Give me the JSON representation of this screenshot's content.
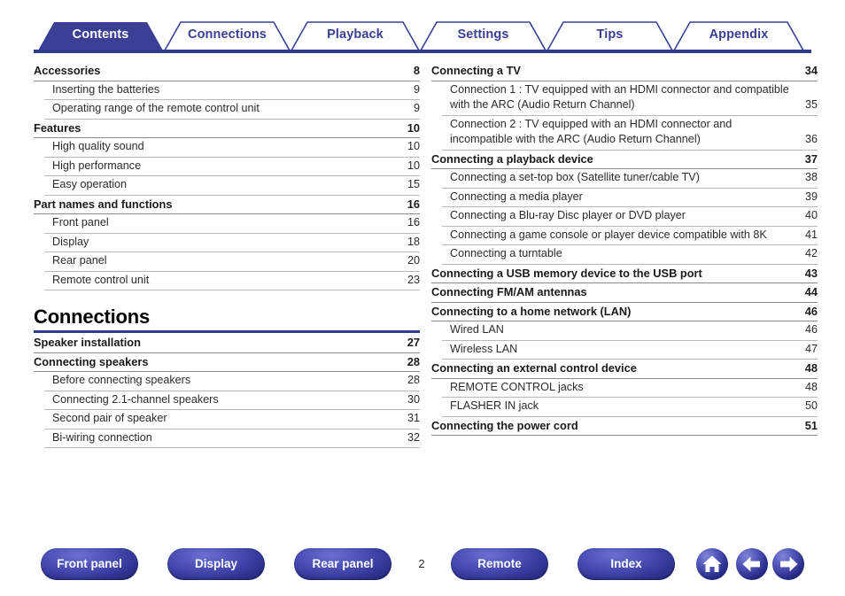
{
  "tabs": [
    {
      "label": "Contents",
      "active": true
    },
    {
      "label": "Connections",
      "active": false
    },
    {
      "label": "Playback",
      "active": false
    },
    {
      "label": "Settings",
      "active": false
    },
    {
      "label": "Tips",
      "active": false
    },
    {
      "label": "Appendix",
      "active": false
    }
  ],
  "colors": {
    "tab_active_fill": "#3b3f94",
    "tab_outline": "#3b3f94",
    "tab_text": "#3b3f94",
    "tab_text_active": "#ffffff",
    "section_rule": "#2f3b8c",
    "button_blue": "#2f3392"
  },
  "left_column": {
    "entries": [
      {
        "level": 1,
        "title": "Accessories",
        "page": "8"
      },
      {
        "level": 2,
        "title": "Inserting the batteries",
        "page": "9"
      },
      {
        "level": 2,
        "title": "Operating range of the remote control unit",
        "page": "9"
      },
      {
        "level": 1,
        "title": "Features",
        "page": "10"
      },
      {
        "level": 2,
        "title": "High quality sound",
        "page": "10"
      },
      {
        "level": 2,
        "title": "High performance",
        "page": "10"
      },
      {
        "level": 2,
        "title": "Easy operation",
        "page": "15"
      },
      {
        "level": 1,
        "title": "Part names and functions",
        "page": "16"
      },
      {
        "level": 2,
        "title": "Front panel",
        "page": "16"
      },
      {
        "level": 2,
        "title": "Display",
        "page": "18"
      },
      {
        "level": 2,
        "title": "Rear panel",
        "page": "20"
      },
      {
        "level": 2,
        "title": "Remote control unit",
        "page": "23"
      }
    ],
    "section": {
      "title": "Connections",
      "entries": [
        {
          "level": 1,
          "title": "Speaker installation",
          "page": "27"
        },
        {
          "level": 1,
          "title": "Connecting speakers",
          "page": "28"
        },
        {
          "level": 2,
          "title": "Before connecting speakers",
          "page": "28"
        },
        {
          "level": 2,
          "title": "Connecting 2.1-channel speakers",
          "page": "30"
        },
        {
          "level": 2,
          "title": "Second pair of speaker",
          "page": "31"
        },
        {
          "level": 2,
          "title": "Bi-wiring connection",
          "page": "32"
        }
      ]
    }
  },
  "right_column": {
    "entries": [
      {
        "level": 1,
        "title": "Connecting a TV",
        "page": "34"
      },
      {
        "level": 2,
        "title": "Connection 1 : TV equipped with an HDMI connector and compatible with the ARC (Audio Return Channel)",
        "page": "35"
      },
      {
        "level": 2,
        "title": "Connection 2 : TV equipped with an HDMI connector and incompatible with the ARC (Audio Return Channel)",
        "page": "36"
      },
      {
        "level": 1,
        "title": "Connecting a playback device",
        "page": "37"
      },
      {
        "level": 2,
        "title": "Connecting a set-top box (Satellite tuner/cable TV)",
        "page": "38"
      },
      {
        "level": 2,
        "title": "Connecting a media player",
        "page": "39"
      },
      {
        "level": 2,
        "title": "Connecting a Blu-ray Disc player or DVD player",
        "page": "40"
      },
      {
        "level": 2,
        "title": "Connecting a game console or player device compatible with 8K",
        "page": "41"
      },
      {
        "level": 2,
        "title": "Connecting a turntable",
        "page": "42"
      },
      {
        "level": 1,
        "title": "Connecting a USB memory device to the USB port",
        "page": "43"
      },
      {
        "level": 1,
        "title": "Connecting FM/AM antennas",
        "page": "44"
      },
      {
        "level": 1,
        "title": "Connecting to a home network (LAN)",
        "page": "46"
      },
      {
        "level": 2,
        "title": "Wired LAN",
        "page": "46"
      },
      {
        "level": 2,
        "title": "Wireless LAN",
        "page": "47"
      },
      {
        "level": 1,
        "title": "Connecting an external control device",
        "page": "48"
      },
      {
        "level": 2,
        "title": "REMOTE CONTROL jacks",
        "page": "48"
      },
      {
        "level": 2,
        "title": "FLASHER IN jack",
        "page": "50"
      },
      {
        "level": 1,
        "title": "Connecting the power cord",
        "page": "51"
      }
    ]
  },
  "footer": {
    "buttons": [
      {
        "label": "Front panel"
      },
      {
        "label": "Display"
      },
      {
        "label": "Rear panel"
      },
      {
        "label": "Remote"
      },
      {
        "label": "Index"
      }
    ],
    "icons": [
      {
        "name": "home-icon"
      },
      {
        "name": "arrow-left-icon"
      },
      {
        "name": "arrow-right-icon"
      }
    ],
    "page_number": "2"
  }
}
